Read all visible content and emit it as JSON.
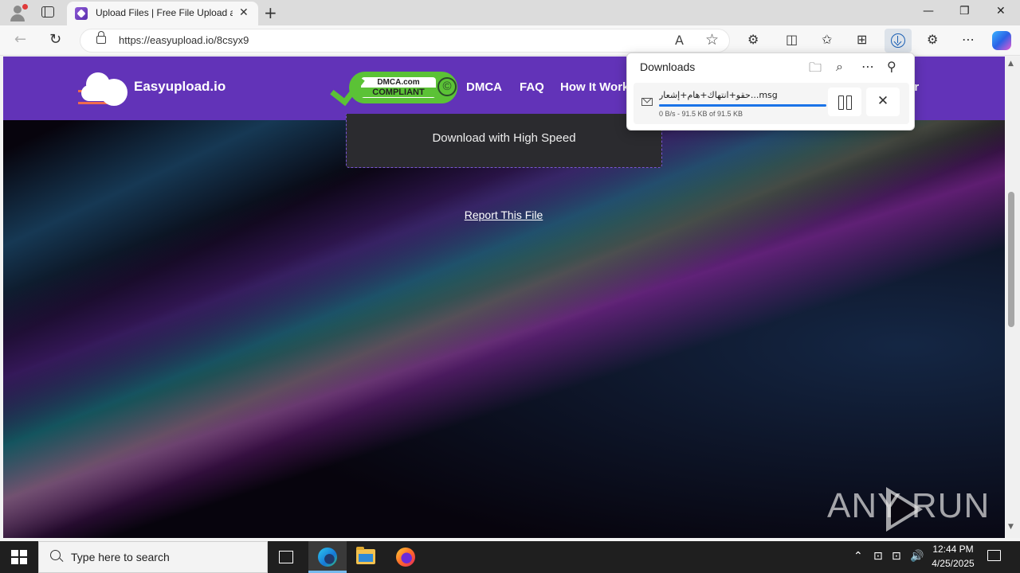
{
  "browser": {
    "tab": {
      "title": "Upload Files | Free File Upload and",
      "close_glyph": "✕"
    },
    "new_tab_glyph": "+",
    "window_controls": {
      "minimize": "—",
      "restore": "❐",
      "close": "✕"
    },
    "nav": {
      "back": "←",
      "refresh": "↻"
    },
    "address": {
      "url": "https://easyupload.io/8csyx9",
      "read_aloud": "A",
      "favorite": "☆"
    },
    "toolbar_icons": {
      "extensions": "⚙",
      "split": "◫",
      "favorites": "✩",
      "collections": "⊞",
      "more": "⋯"
    }
  },
  "site": {
    "logo_text": "Easyupload.io",
    "dmca": {
      "line1": "DMCA.com",
      "line2": "COMPLIANT",
      "copyright": "©"
    },
    "nav": {
      "dmca": "DMCA",
      "faq": "FAQ",
      "how": "How It Works",
      "trailing": "er"
    },
    "download_button": "Download with High Speed",
    "report_link": "Report This File",
    "watermark": "ANY    RUN"
  },
  "downloads": {
    "title": "Downloads",
    "header_icons": {
      "folder": "🗀",
      "search": "⌕",
      "more": "⋯",
      "pin": "⚲"
    },
    "item": {
      "filename": "حقو+انتهاك+هام+إشعار...msg",
      "status": "0 B/s - 91.5 KB of 91.5 KB",
      "progress_fraction": 1.0,
      "cancel_glyph": "✕"
    }
  },
  "taskbar": {
    "search_placeholder": "Type here to search",
    "tray": {
      "chevron": "⌃",
      "network": "⊡",
      "volume": "🔊"
    },
    "clock": {
      "time": "12:44 PM",
      "date": "4/25/2025"
    }
  }
}
